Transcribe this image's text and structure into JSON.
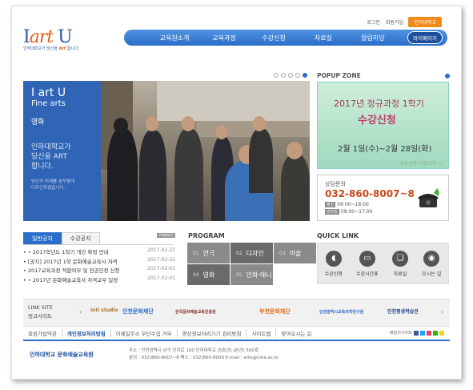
{
  "header": {
    "logo_prefix": "I",
    "logo_art": "art",
    "logo_suffix": " U",
    "logo_sub_pre": "인하대학교가 당신을 ",
    "logo_sub_art": "Art",
    "logo_sub_post": " 합니다.",
    "toplinks": [
      "로그인",
      "회원가입"
    ],
    "top_button": "인하대학교",
    "nav": [
      "교육원소개",
      "교육과정",
      "수강신청",
      "자료실",
      "알림마당"
    ],
    "mypage": "마이페이지"
  },
  "hero": {
    "title1": "I art U",
    "title2": "Fine arts",
    "category": "영화",
    "slogan1": "인하대학교가",
    "slogan2": "당신을 ART",
    "slogan3": "합니다.",
    "small1": "당신의 미래를 꿈꾸움게",
    "small2": "디자인하겠습니다."
  },
  "popup": {
    "zone_label": "POPUP ZONE",
    "line1": "2017년 정규과정 1학기",
    "line2": "수강신청",
    "line3": "2월 1일(수)~2월 28일(화)",
    "link": "수강신청 바로가기 >"
  },
  "consult": {
    "label": "상담문의",
    "phone": "032-860-8007~8",
    "weekday_lbl": "평일",
    "weekday": "09:00~18:00",
    "vacation_lbl": "방학중",
    "vacation": "09:00~17:00"
  },
  "notice": {
    "tabs": [
      "일반공지",
      "수강공지"
    ],
    "more": "more+",
    "items": [
      {
        "title": "• • 2017학년도 1학기 개강 확정 안내",
        "date": "2017-02-22"
      },
      {
        "title": "• [공지] 2017년 1학 문화예술교육사 자격",
        "date": "2017-02-22"
      },
      {
        "title": "• 2017교육과정 적합여부 및 전공인정 신청",
        "date": "2017-02-01"
      },
      {
        "title": "• • 2017년 문화예술교육사 자격교부 일정",
        "date": "2017-02-01"
      }
    ]
  },
  "program": {
    "heading": "PROGRAM",
    "items": [
      {
        "num": "01",
        "label": "연극"
      },
      {
        "num": "02",
        "label": "디자인"
      },
      {
        "num": "03",
        "label": "미술"
      },
      {
        "num": "04",
        "label": "영화"
      },
      {
        "num": "05",
        "label": "만화·애니"
      }
    ]
  },
  "quicklink": {
    "heading": "QUICK LINK",
    "items": [
      "수강신청",
      "수강시간표",
      "자료실",
      "오시는 길"
    ]
  },
  "linksite": {
    "heading_en": "LINK SITE",
    "heading_ko": "링크사이트",
    "items": [
      "inU studio",
      "인천문화재단",
      "한국문화예술교육진흥원",
      "부천문화재단",
      "인천광역시교육과학연구원",
      "인천평생학습관"
    ]
  },
  "footer": {
    "links": [
      "회원가입약관",
      "개인정보처리방침",
      "이메일주소 무단수집 거부",
      "영상정보처리기기 관리방침",
      "사이트맵",
      "찾아오시는 길"
    ],
    "family_label": "패밀리사이트",
    "org": "인하대학교 문화예술교육원",
    "address": "주소 : 인천광역시 남구 인하로 100 인하대학교 [5호관] (본관) 500호",
    "contact": "문의 : 032)860-8007~8   팩스 : 032)860-8009   E-mail : arte@inha.ac.kr"
  }
}
